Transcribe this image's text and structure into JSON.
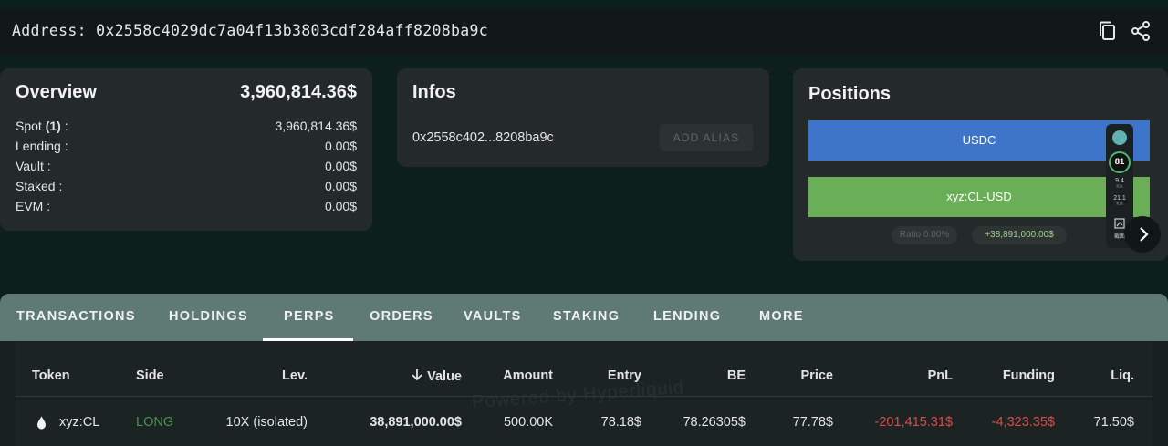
{
  "header": {
    "address_label": "Address: 0x2558c4029dc7a04f13b3803cdf284aff8208ba9c",
    "copy_icon": "copy-icon",
    "share_icon": "share-icon"
  },
  "overview": {
    "title": "Overview",
    "total": "3,960,814.36$",
    "rows": [
      {
        "label": "Spot (1) :",
        "value": "3,960,814.36$"
      },
      {
        "label": "Lending :",
        "value": "0.00$"
      },
      {
        "label": "Vault :",
        "value": "0.00$"
      },
      {
        "label": "Staked :",
        "value": "0.00$"
      },
      {
        "label": "EVM :",
        "value": "0.00$"
      }
    ]
  },
  "infos": {
    "title": "Infos",
    "short_address": "0x2558c402...8208ba9c",
    "add_alias_label": "ADD ALIAS"
  },
  "positions": {
    "title": "Positions",
    "bars": [
      {
        "label": "USDC",
        "color": "#3f75c9"
      },
      {
        "label": "xyz:CL-USD",
        "color": "#6aae58"
      }
    ],
    "ratio_label": "Ratio 0.00%",
    "pnl_label": "+38,891,000.00$"
  },
  "overlay_widget": {
    "badge": "81",
    "stat1_value": "9.4",
    "stat1_unit": "K/s",
    "stat2_value": "21.1",
    "stat2_unit": "K/s",
    "screenshot_label": "截图"
  },
  "tabs": [
    {
      "label": "TRANSACTIONS"
    },
    {
      "label": "HOLDINGS"
    },
    {
      "label": "PERPS",
      "active": true
    },
    {
      "label": "ORDERS"
    },
    {
      "label": "VAULTS"
    },
    {
      "label": "STAKING"
    },
    {
      "label": "LENDING"
    },
    {
      "label": "MORE"
    }
  ],
  "table": {
    "headers": [
      "Token",
      "Side",
      "Lev.",
      "Value",
      "Amount",
      "Entry",
      "BE",
      "Price",
      "PnL",
      "Funding",
      "Liq."
    ],
    "sort_icon": "arrow-down-icon",
    "token_icon": "drop-icon",
    "watermark": "Powered by Hyperliquid",
    "rows": [
      {
        "token": "xyz:CL",
        "side": "LONG",
        "lev": "10X (isolated)",
        "value": "38,891,000.00$",
        "amount": "500.00K",
        "entry": "78.18$",
        "be": "78.26305$",
        "price": "77.78$",
        "pnl": "-201,415.31$",
        "funding": "-4,323.35$",
        "liq": "71.50$"
      }
    ],
    "colors": {
      "long": "#4e8f56",
      "negative": "#e04848"
    }
  }
}
